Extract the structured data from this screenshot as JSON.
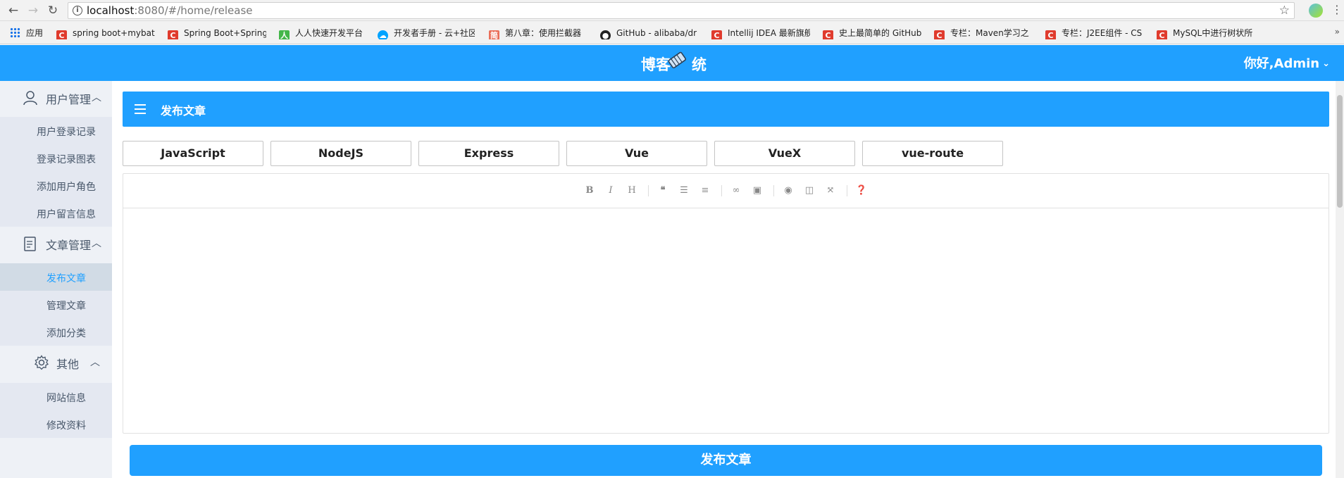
{
  "browser": {
    "url_host": "localhost",
    "url_rest": ":8080/#/home/release",
    "bookmarks": [
      {
        "label": "应用",
        "icon": "apps-grid-icon",
        "color": "#1a73e8"
      },
      {
        "label": "spring boot+mybat",
        "icon": "csdn-icon",
        "color": "#e03b2d"
      },
      {
        "label": "Spring Boot+Spring",
        "icon": "csdn-icon",
        "color": "#e03b2d"
      },
      {
        "label": "人人快速开发平台",
        "icon": "renren-icon",
        "color": "#43b649"
      },
      {
        "label": "开发者手册 - 云+社区",
        "icon": "cloud-icon",
        "color": "#00a3ff"
      },
      {
        "label": "第八章：使用拦截器",
        "icon": "jianshu-icon",
        "color": "#ea6f5a"
      },
      {
        "label": "GitHub - alibaba/dr",
        "icon": "github-icon",
        "color": "#222222"
      },
      {
        "label": "Intellij IDEA 最新旗舰",
        "icon": "csdn-icon",
        "color": "#e03b2d"
      },
      {
        "label": "史上最简单的 GitHub",
        "icon": "csdn-icon",
        "color": "#e03b2d"
      },
      {
        "label": "专栏：Maven学习之",
        "icon": "csdn-icon",
        "color": "#e03b2d"
      },
      {
        "label": "专栏：J2EE组件 - CS",
        "icon": "csdn-icon",
        "color": "#e03b2d"
      },
      {
        "label": "MySQL中进行树状所",
        "icon": "csdn-icon",
        "color": "#e03b2d"
      }
    ]
  },
  "header": {
    "brand_left": "博客",
    "brand_right": "统",
    "user_greeting": "你好,Admin",
    "accent": "#20a0ff"
  },
  "sidebar": {
    "groups": [
      {
        "title": "用户管理",
        "icon": "user-icon",
        "items": [
          "用户登录记录",
          "登录记录图表",
          "添加用户角色",
          "用户留言信息"
        ]
      },
      {
        "title": "文章管理",
        "icon": "document-icon",
        "items": [
          "发布文章",
          "管理文章",
          "添加分类"
        ]
      },
      {
        "title": "其他",
        "icon": "gear-icon",
        "items": [
          "网站信息",
          "修改资料"
        ]
      }
    ],
    "active_item": "发布文章"
  },
  "main": {
    "panel_title": "发布文章",
    "tags": [
      "JavaScript",
      "NodeJS",
      "Express",
      "Vue",
      "VueX",
      "vue-route"
    ],
    "toolbar_icons": [
      "bold-icon",
      "italic-icon",
      "heading-icon",
      "quote-icon",
      "unordered-list-icon",
      "ordered-list-icon",
      "link-icon",
      "image-icon",
      "preview-icon",
      "side-by-side-icon",
      "fullscreen-icon",
      "help-icon"
    ],
    "publish_label": "发布文章"
  }
}
